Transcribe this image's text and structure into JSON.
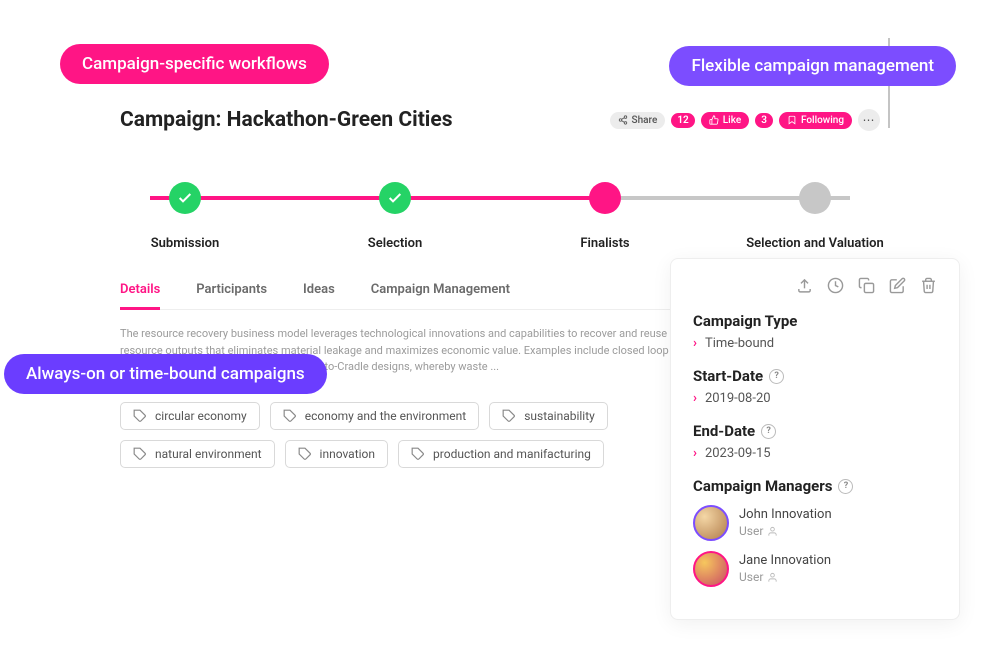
{
  "featurePills": {
    "workflows": "Campaign-specific workflows",
    "flexible": "Flexible campaign management",
    "timebound": "Always-on or time-bound campaigns"
  },
  "header": {
    "title": "Campaign: Hackathon-Green Cities",
    "shareLabel": "Share",
    "likeCount": "12",
    "likeLabel": "Like",
    "followCount": "3",
    "followLabel": "Following"
  },
  "stages": [
    {
      "label": "Submission",
      "state": "done"
    },
    {
      "label": "Selection",
      "state": "done"
    },
    {
      "label": "Finalists",
      "state": "current"
    },
    {
      "label": "Selection and Valuation",
      "state": "future"
    }
  ],
  "tabs": {
    "details": "Details",
    "participants": "Participants",
    "ideas": "Ideas",
    "management": "Campaign Management"
  },
  "description": "The resource recovery business model leverages technological innovations and capabilities to recover and reuse resource outputs that eliminates material leakage and maximizes economic value. Examples include closed loop recycling, industrial symbiosis and Cradle-to-Cradle designs, whereby waste ...",
  "tags": [
    "circular economy",
    "economy and the environment",
    "sustainability",
    "natural environment",
    "innovation",
    "production and manifacturing"
  ],
  "side": {
    "typeLabel": "Campaign Type",
    "typeValue": "Time-bound",
    "startLabel": "Start-Date",
    "startValue": "2019-08-20",
    "endLabel": "End-Date",
    "endValue": "2023-09-15",
    "managersLabel": "Campaign Managers",
    "managers": [
      {
        "name": "John Innovation",
        "role": "User"
      },
      {
        "name": "Jane Innovation",
        "role": "User"
      }
    ]
  }
}
